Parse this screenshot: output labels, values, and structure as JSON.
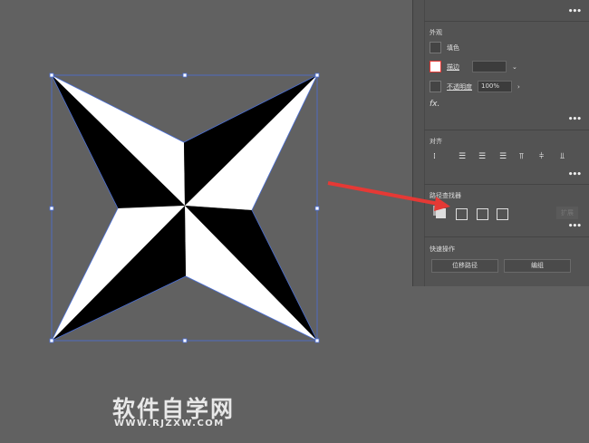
{
  "panel": {
    "appearance": {
      "title": "外观",
      "fill_label": "填色",
      "stroke_label": "描边",
      "stroke_value": "",
      "opacity_label": "不透明度",
      "opacity_value": "100%",
      "fx_label": "fx."
    },
    "align": {
      "title": "对齐"
    },
    "pathfinder": {
      "title": "路径查找器",
      "expand_label": "扩展"
    },
    "quick_actions": {
      "title": "快速操作",
      "offset_path": "位移路径",
      "group": "编组"
    },
    "more": "•••"
  },
  "watermark": {
    "title": "软件自学网",
    "url": "WWW.RJZXW.COM"
  },
  "colors": {
    "background": "#616161",
    "panel": "#535353",
    "selection": "#4a6fd8",
    "arrow": "#e53935"
  }
}
